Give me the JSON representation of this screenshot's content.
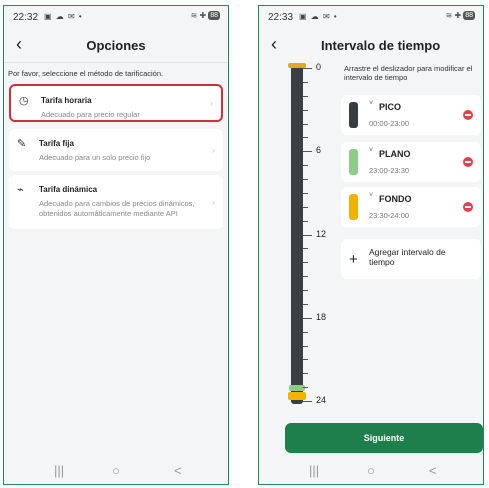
{
  "left": {
    "status_time": "22:32",
    "status_icons": "▣ ☁ ✉ •",
    "status_right": "≋ ✚",
    "battery": "88",
    "title": "Opciones",
    "hint": "Por favor, seleccione el método de tarificación.",
    "options": [
      {
        "title": "Tarifa horaria",
        "desc": "Adecuado para precio regular"
      },
      {
        "title": "Tarifa fija",
        "desc": "Adecuado para un solo precio fijo"
      },
      {
        "title": "Tarifa dinámica",
        "desc": "Adecuado para cambios de precios dinámicos, obtenidos automáticamente mediante API"
      }
    ]
  },
  "right": {
    "status_time": "22:33",
    "status_icons": "▣ ☁ ✉ •",
    "status_right": "≋ ✚",
    "battery": "88",
    "title": "Intervalo de tiempo",
    "hint": "Arrastre el deslizador para modificar el intervalo de tiempo",
    "scale_labels": [
      "0",
      "6",
      "12",
      "18",
      "24"
    ],
    "intervals": [
      {
        "name": "PICO",
        "time": "00:00-23:00",
        "color": "#3a3d40"
      },
      {
        "name": "PLANO",
        "time": "23:00-23:30",
        "color": "#8ccd8a"
      },
      {
        "name": "FONDO",
        "time": "23:30-24:00",
        "color": "#f0b400"
      }
    ],
    "add_label": "Agregar intervalo de tiempo",
    "next_label": "Siguiente"
  },
  "nav": {
    "recents": "|||",
    "home": "○",
    "back": "<"
  },
  "icons": {
    "back": "chevron-left-icon",
    "opt1": "clock-icon",
    "opt2": "pencil-icon",
    "opt3": "pulse-icon",
    "chevron": "chevron-right-icon",
    "arrow": "chevron-down-icon",
    "remove": "remove-icon",
    "add": "plus-icon"
  }
}
